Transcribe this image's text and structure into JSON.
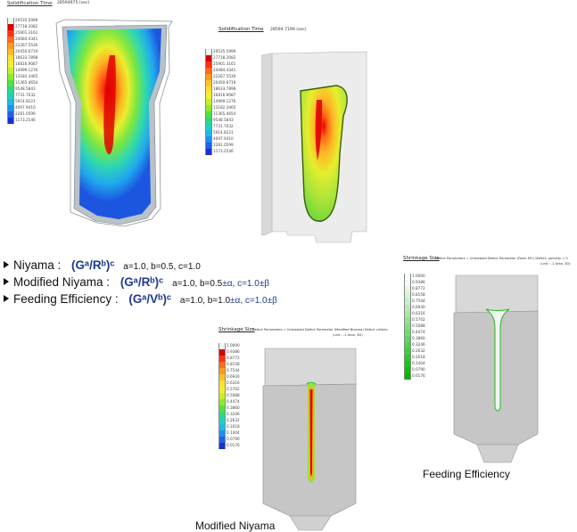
{
  "panels": {
    "solid_niyama_left": {
      "title": "Solidification Time",
      "value_header": "28594975 (sec)",
      "ticks": [
        "29535.5999",
        "27718.2082",
        "25901.3161",
        "24084.4341",
        "22267.5530",
        "20450.6719",
        "18633.7898",
        "16816.9087",
        "14999.1276",
        "13182.3465",
        "11365.4654",
        "9548.5843",
        "7731.7032",
        "5914.8221",
        "4097.9410",
        "2281.0599",
        "1173.2546"
      ]
    },
    "solid_right": {
      "title": "Solidification Time",
      "value_header": "28594.7199 (sec)",
      "ticks": [
        "29535.5999",
        "27718.2082",
        "25901.3161",
        "24084.4341",
        "22267.5530",
        "20450.6719",
        "18633.7898",
        "16816.9087",
        "14999.1276",
        "13182.3465",
        "11365.4654",
        "9548.5843",
        "7731.7032",
        "5914.8221",
        "4097.9410",
        "2281.0599",
        "1173.2546"
      ]
    },
    "shrinkage_feeding": {
      "title": "Shrinkage Size",
      "header": "Defect Parameters  = Unmasked Defect Parameter (Feed. Eff.)   Defect: porosity  = 0",
      "subheader": "(unit : -1 Area, 3D)",
      "ticks": [
        "1.0000",
        "0.9386",
        "0.8772",
        "0.8158",
        "0.7544",
        "0.6930",
        "0.6316",
        "0.5702",
        "0.5088",
        "0.4474",
        "0.3860",
        "0.3246",
        "0.2632",
        "0.2018",
        "0.1404",
        "0.0790",
        "0.0176"
      ]
    },
    "shrinkage_modified": {
      "title": "Shrinkage Size",
      "header": "Defect Parameters  = Unmasked Defect Parameter (Modified Niyama)   Defect criteria",
      "subheader": "(unit : -1 Area, 3D)",
      "ticks": [
        "1.0000",
        "0.9386",
        "0.8772",
        "0.8158",
        "0.7544",
        "0.6930",
        "0.6316",
        "0.5702",
        "0.5088",
        "0.4474",
        "0.3860",
        "0.3246",
        "0.2632",
        "0.2018",
        "0.1404",
        "0.0790",
        "0.0176"
      ]
    }
  },
  "criteria": [
    {
      "label": "Niyama :",
      "formula": "(Gᵃ/Rᵇ)ᶜ",
      "params": "a=1.0, b=0.5, c=1.0",
      "extra": ""
    },
    {
      "label": "Modified Niyama :",
      "formula": "(Gᵃ/Rᵇ)ᶜ",
      "params": "a=1.0, b=0.5",
      "extra": "±α, c=1.0±β"
    },
    {
      "label": "Feeding Efficiency :",
      "formula": "(Gᵃ/Vᵇ)ᶜ",
      "params": "a=1.0, b=1.0",
      "extra": "±α, c=1.0±β"
    }
  ],
  "captions": {
    "feeding": "Feeding Efficiency",
    "modified": "Modified Niyama"
  },
  "colors": {
    "rainbow": [
      "#f4f4f4",
      "#d40000",
      "#ff3010",
      "#ff6a1a",
      "#ff9a20",
      "#ffc02a",
      "#ffe030",
      "#f2f030",
      "#c8ee30",
      "#90e830",
      "#55e040",
      "#30d880",
      "#20d0c0",
      "#20b8e8",
      "#2090f0",
      "#2060e8",
      "#1830d0"
    ],
    "greens": [
      "#ffffff",
      "#f2fbf2",
      "#e4f8e4",
      "#d6f4d6",
      "#c8f0c8",
      "#b6ecb6",
      "#a4e8a4",
      "#92e492",
      "#80e080",
      "#6edc6e",
      "#5cd85c",
      "#4ad44a",
      "#38d038",
      "#26cc26",
      "#14c814",
      "#08c008",
      "#00b800"
    ]
  }
}
